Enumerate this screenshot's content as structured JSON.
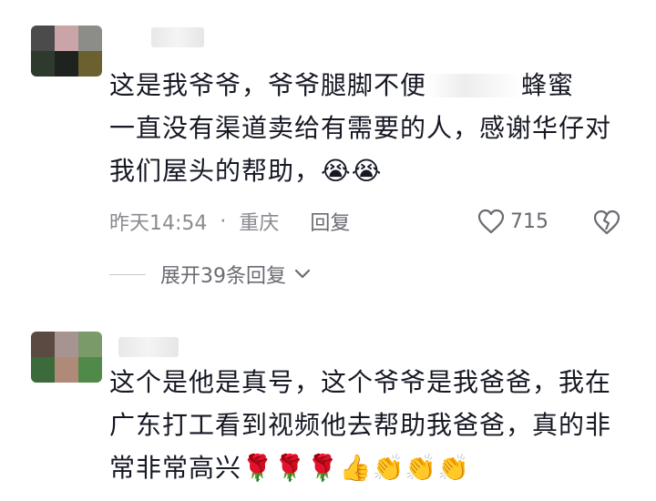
{
  "comments": [
    {
      "lines": [
        "这是我爷爷，爷爷腿脚不便",
        "蜂蜜",
        "一直没有渠道卖给有需要的人，感谢华仔对",
        "我们屋头的帮助，"
      ],
      "emojis": "😭😭",
      "time": "昨天14:54",
      "location": "重庆",
      "reply_label": "回复",
      "likes": "715",
      "expand_label": "展开39条回复"
    },
    {
      "lines": [
        "这个是他是真号，这个爷爷是我爸爸，我在",
        "广东打工看到视频他去帮助我爸爸，真的非",
        "常非常高兴"
      ],
      "emojis": "🌹🌹🌹👍👏👏👏"
    }
  ],
  "colors": {
    "text": "#161823",
    "meta": "#8a8b91",
    "icon": "#6a6b72"
  },
  "icons": {
    "like": "heart-outline-icon",
    "dislike": "broken-heart-icon",
    "expand": "chevron-down-icon"
  }
}
